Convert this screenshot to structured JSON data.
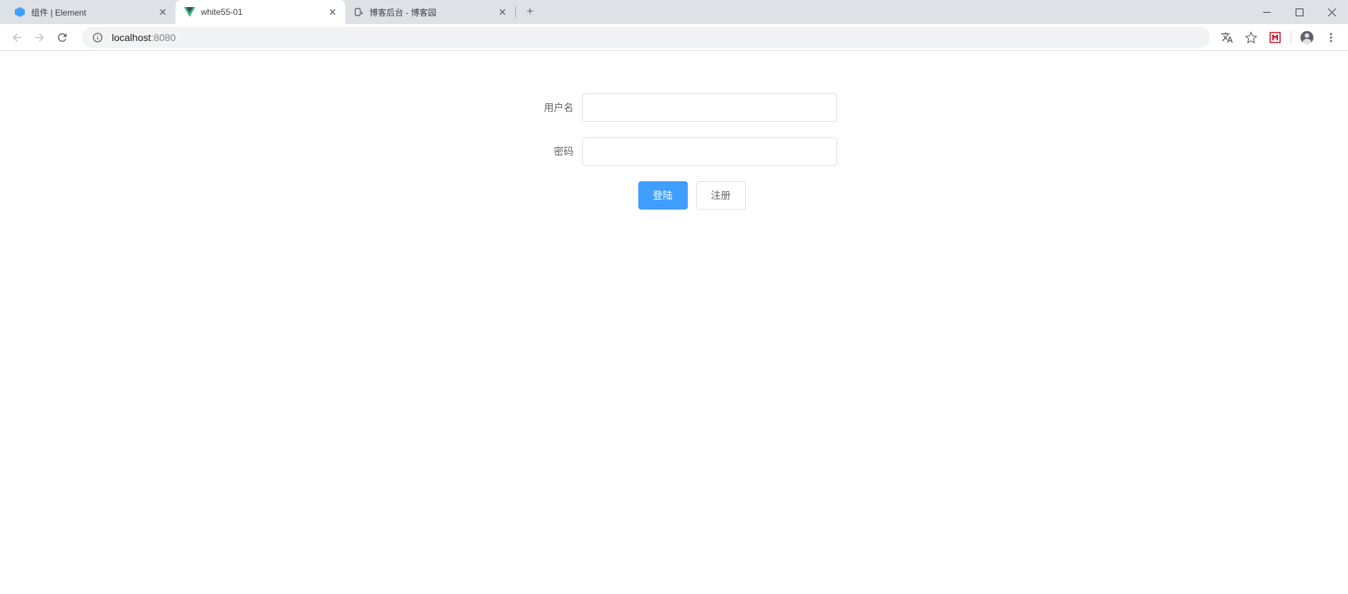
{
  "tabs": [
    {
      "title": "组件 | Element"
    },
    {
      "title": "white55-01"
    },
    {
      "title": "博客后台 - 博客园"
    }
  ],
  "url": {
    "host": "localhost",
    "port": ":8080"
  },
  "form": {
    "username_label": "用户名",
    "password_label": "密码",
    "username_value": "",
    "password_value": "",
    "login_button": "登陆",
    "register_button": "注册"
  }
}
